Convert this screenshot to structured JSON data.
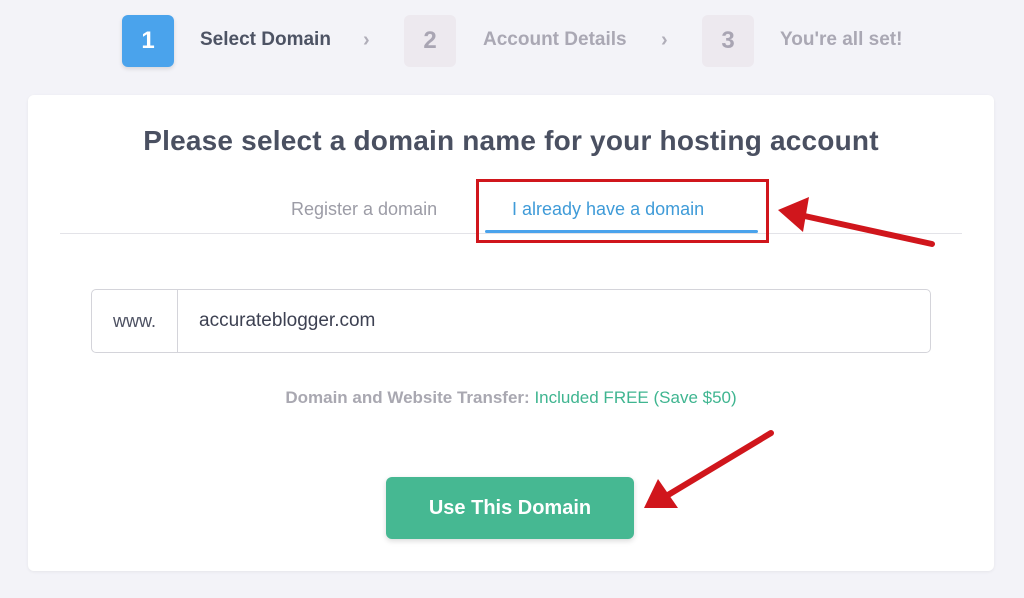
{
  "stepper": {
    "steps": [
      {
        "number": "1",
        "label": "Select Domain",
        "state": "active"
      },
      {
        "number": "2",
        "label": "Account Details",
        "state": "inactive"
      },
      {
        "number": "3",
        "label": "You're all set!",
        "state": "inactive"
      }
    ],
    "separator_icon": "chevron-right-icon"
  },
  "card": {
    "title": "Please select a domain name for your hosting account",
    "tabs": [
      {
        "label": "Register a domain",
        "selected": false
      },
      {
        "label": "I already have a domain",
        "selected": true
      }
    ],
    "domain": {
      "prefix": "www.",
      "value": "accurateblogger.com"
    },
    "transfer": {
      "label": "Domain and Website Transfer:",
      "value": "Included FREE (Save $50)"
    },
    "button_label": "Use This Domain"
  },
  "annotations": {
    "highlight_color": "#d0161c",
    "arrow_color": "#d0161c",
    "arrow_icons": [
      "arrow-pointing-tab-icon",
      "arrow-pointing-button-icon"
    ]
  },
  "colors": {
    "accent_blue": "#4aa3ec",
    "accent_green": "#46b892",
    "background": "#f3f3f8"
  }
}
